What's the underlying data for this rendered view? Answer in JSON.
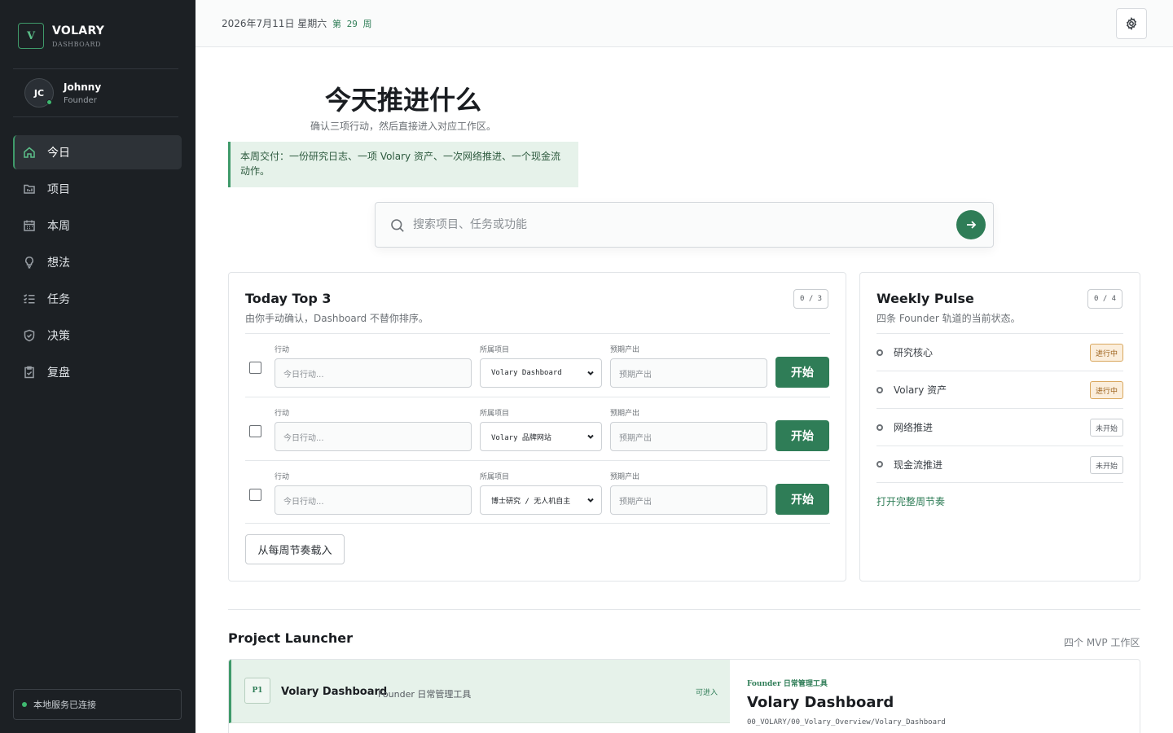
{
  "brand": {
    "mark": "V",
    "name": "VOLARY",
    "subtitle": "DASHBOARD"
  },
  "user": {
    "initials": "JC",
    "name": "Johnny",
    "role": "Founder"
  },
  "nav": [
    {
      "label": "今日",
      "icon": "home-icon",
      "active": true
    },
    {
      "label": "项目",
      "icon": "folder-icon",
      "active": false
    },
    {
      "label": "本周",
      "icon": "calendar-icon",
      "active": false
    },
    {
      "label": "想法",
      "icon": "lightbulb-icon",
      "active": false
    },
    {
      "label": "任务",
      "icon": "checklist-icon",
      "active": false
    },
    {
      "label": "决策",
      "icon": "shield-icon",
      "active": false
    },
    {
      "label": "复盘",
      "icon": "clipboard-icon",
      "active": false
    }
  ],
  "service_status": "本地服务已连接",
  "header": {
    "date": "2026年7月11日 星期六",
    "week": "第 29 周"
  },
  "hero": {
    "title": "今天推进什么",
    "subtitle": "确认三项行动，然后直接进入对应工作区。",
    "callout": "本周交付：一份研究日志、一项 Volary 资产、一次网络推进、一个现金流动作。"
  },
  "search": {
    "placeholder": "搜索项目、任务或功能"
  },
  "top3": {
    "title": "Today Top 3",
    "subtitle": "由你手动确认，Dashboard 不替你排序。",
    "counter": "0 / 3",
    "label_action": "行动",
    "label_project": "所属项目",
    "label_output": "预期产出",
    "action_placeholder": "今日行动...",
    "output_placeholder": "预期产出",
    "start_label": "开始",
    "rows": [
      {
        "project": "Volary Dashboard"
      },
      {
        "project": "Volary 品牌网站"
      },
      {
        "project": "博士研究 / 无人机自主"
      }
    ],
    "load_label": "从每周节奏载入"
  },
  "pulse": {
    "title": "Weekly Pulse",
    "subtitle": "四条 Founder 轨道的当前状态。",
    "counter": "0 / 4",
    "items": [
      {
        "label": "研究核心",
        "status": "进行中",
        "state": "doing"
      },
      {
        "label": "Volary 资产",
        "status": "进行中",
        "state": "doing"
      },
      {
        "label": "网络推进",
        "status": "未开始",
        "state": "todo"
      },
      {
        "label": "现金流推进",
        "status": "未开始",
        "state": "todo"
      }
    ],
    "link": "打开完整周节奏"
  },
  "launcher": {
    "title": "Project Launcher",
    "meta": "四个 MVP 工作区",
    "projects": [
      {
        "tag": "P1",
        "name": "Volary Dashboard",
        "desc": "Founder 日常管理工具",
        "status": "可进入"
      }
    ],
    "detail": {
      "kicker": "Founder 日常管理工具",
      "title": "Volary Dashboard",
      "path": "00_VOLARY/00_Volary_Overview/Volary_Dashboard"
    }
  },
  "colors": {
    "accent": "#2f7d57",
    "sidebar": "#1c2024",
    "callout_bg": "#e6f2ea",
    "badge_doing": "#fbeedc"
  }
}
